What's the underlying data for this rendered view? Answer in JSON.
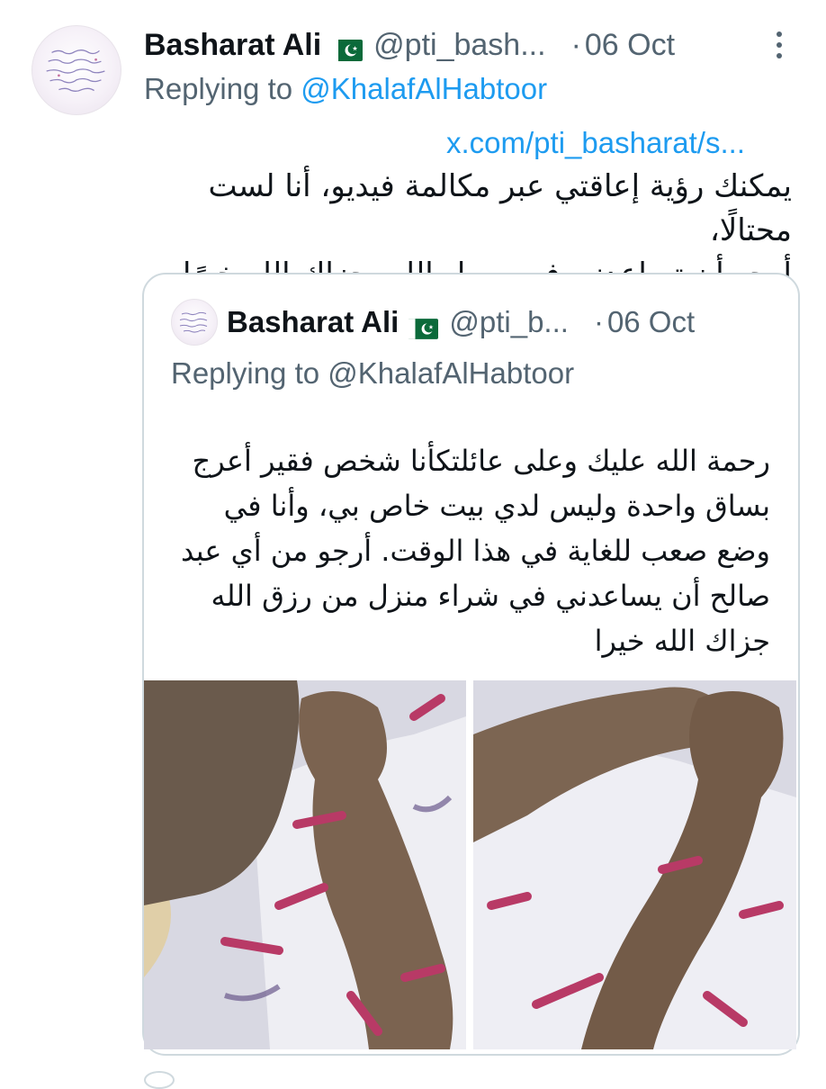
{
  "tweet": {
    "author_name": "Basharat Ali",
    "author_handle": "@pti_bash...",
    "dot": "·",
    "date": "06 Oct",
    "replying_prefix": "Replying to ",
    "replying_mention": "@KhalafAlHabtoor",
    "link": "x.com/pti_basharat/s...",
    "text_line1": "يمكنك رؤية إعاقتي عبر مكالمة فيديو، أنا لست محتالًا،",
    "text_line2": "أرجو أن تساعدني في سبيل الله، جزاك الله خيرًا كثيرًا.",
    "flag_icon": "pakistan-flag-emoji",
    "more_icon": "more-vertical-icon"
  },
  "quoted": {
    "author_name": "Basharat Ali",
    "author_handle": "@pti_b...",
    "dot": "·",
    "date": "06 Oct",
    "replying_prefix": "Replying to ",
    "replying_mention": "@KhalafAlHabtoor",
    "text_lines": [
      "رحمة الله عليك وعلى عائلتكأنا شخص فقير أعرج",
      "بساق واحدة وليس لدي بيت خاص بي، وأنا في",
      "وضع صعب للغاية في هذا الوقت. أرجو من أي عبد",
      "صالح أن يساعدني في شراء منزل من رزق الله",
      "جزاك الله خيرا"
    ],
    "images": [
      "photo-leg-left",
      "photo-leg-right"
    ]
  },
  "colors": {
    "text": "#0f1419",
    "secondary": "#536471",
    "link": "#1d9bf0",
    "border": "#cfd9de"
  }
}
